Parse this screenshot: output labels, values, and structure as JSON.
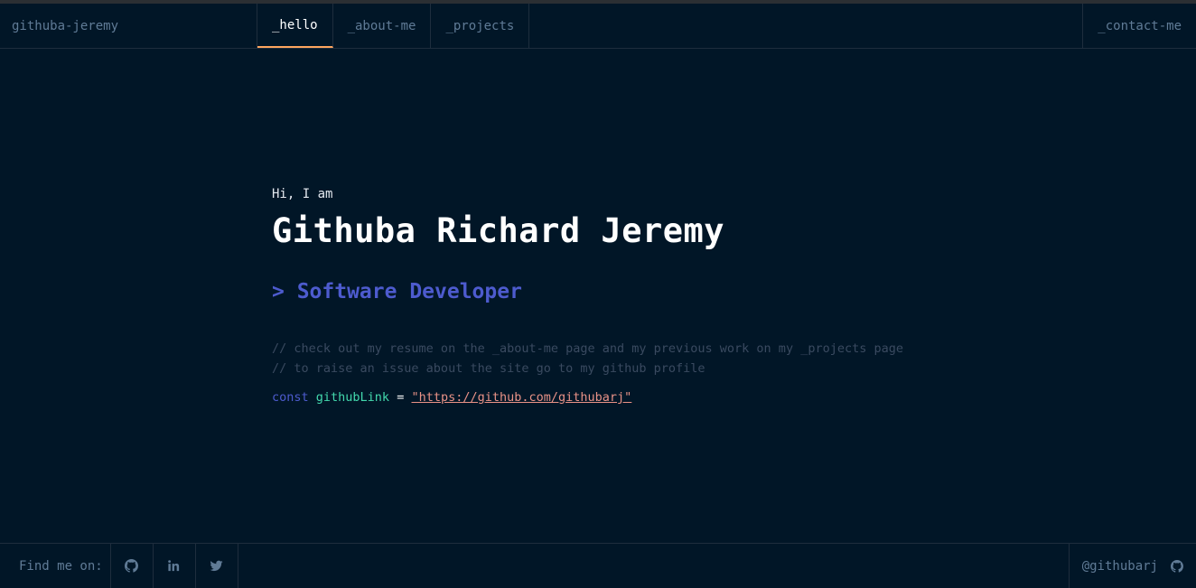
{
  "nav": {
    "brand": "githuba-jeremy",
    "tabs": [
      {
        "label": "_hello",
        "active": true
      },
      {
        "label": "_about-me",
        "active": false
      },
      {
        "label": "_projects",
        "active": false
      }
    ],
    "contact": "_contact-me"
  },
  "hero": {
    "greeting": "Hi, I am",
    "name": "Githuba Richard Jeremy",
    "role": "> Software Developer",
    "comment_1": "// check out my resume on the _about-me page and my previous work on my _projects page",
    "comment_2": "// to raise an issue about the site go to my github profile",
    "code": {
      "keyword": "const",
      "variable": "githubLink",
      "operator": "=",
      "value": "\"https://github.com/githubarj\""
    }
  },
  "footer": {
    "find_me": "Find me on:",
    "socials": [
      {
        "icon": "github-icon"
      },
      {
        "icon": "linkedin-icon"
      },
      {
        "icon": "twitter-icon"
      }
    ],
    "handle": "@githubarj",
    "handle_icon": "github-icon"
  },
  "colors": {
    "background": "#011627",
    "border": "#1e2d3d",
    "text_muted": "#607b96",
    "accent_orange": "#fea55f",
    "accent_blue": "#4d5bce",
    "accent_green": "#43d9ad",
    "accent_string": "#e99287"
  }
}
